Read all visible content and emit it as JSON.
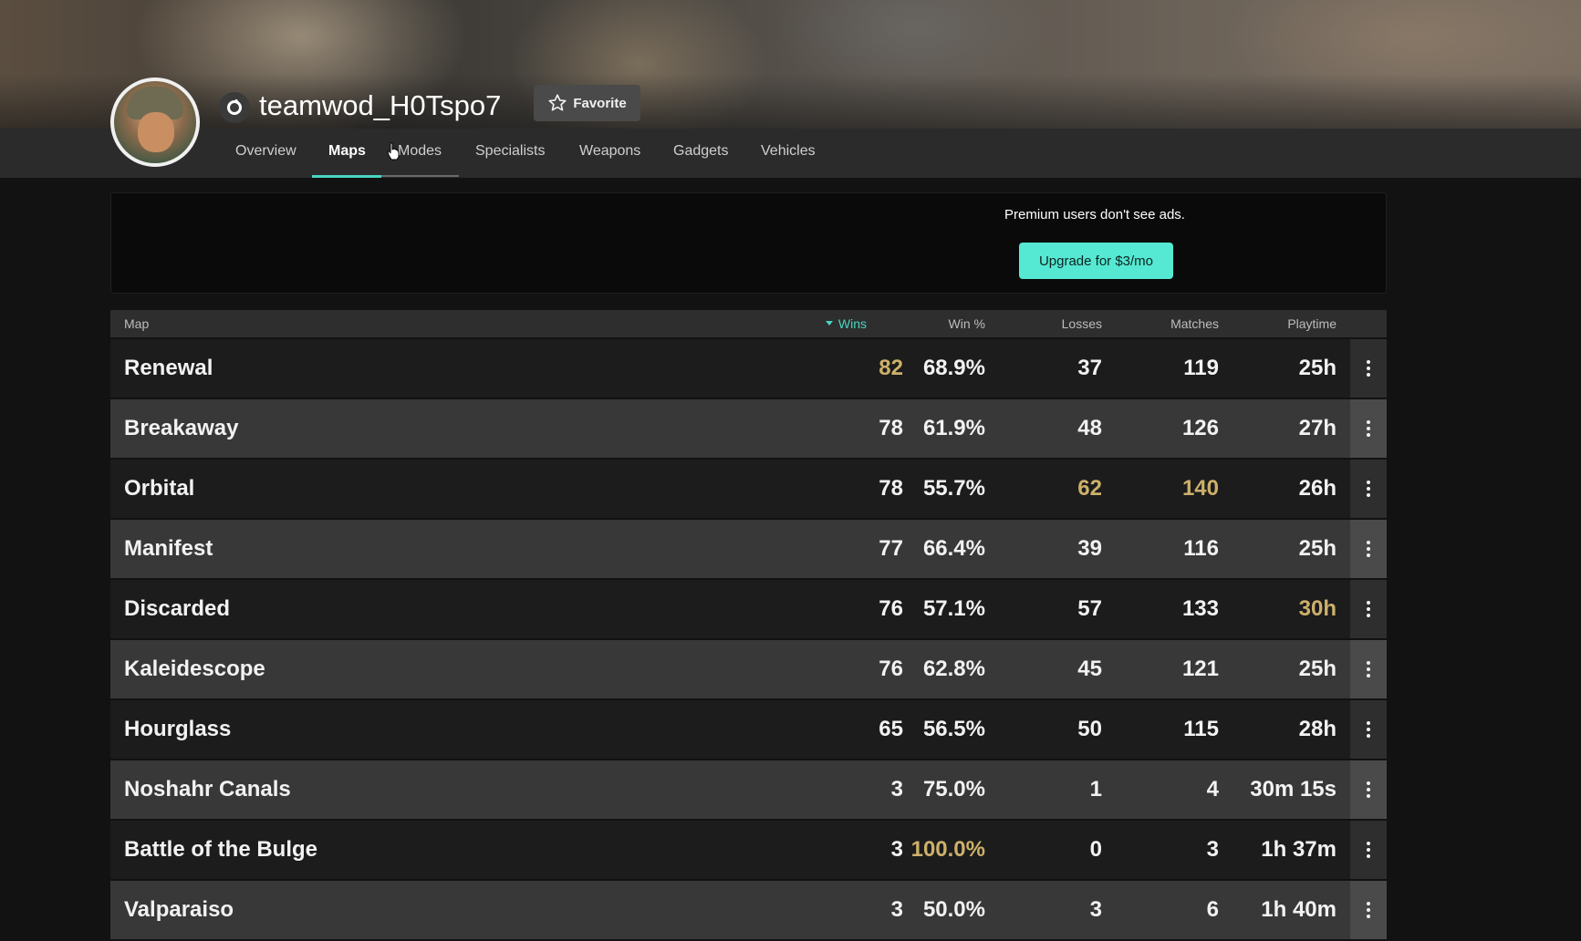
{
  "profile": {
    "username": "teamwod_H0Tspo7",
    "favorite_label": "Favorite",
    "platform_icon": "origin-icon"
  },
  "tabs": [
    {
      "label": "Overview",
      "active": false
    },
    {
      "label": "Maps",
      "active": true
    },
    {
      "label": "Modes",
      "active": false
    },
    {
      "label": "Specialists",
      "active": false
    },
    {
      "label": "Weapons",
      "active": false
    },
    {
      "label": "Gadgets",
      "active": false
    },
    {
      "label": "Vehicles",
      "active": false
    }
  ],
  "ad": {
    "text": "Premium users don't see ads.",
    "upgrade_label": "Upgrade for $3/mo"
  },
  "table": {
    "columns": {
      "map": "Map",
      "wins": "Wins",
      "win_pct": "Win %",
      "losses": "Losses",
      "matches": "Matches",
      "playtime": "Playtime"
    },
    "sorted_by": "wins",
    "highlight_color": "#cdb06a",
    "accent_color": "#48d6c2",
    "rows": [
      {
        "map": "Renewal",
        "wins": "82",
        "win_pct": "68.9%",
        "losses": "37",
        "matches": "119",
        "playtime": "25h"
      },
      {
        "map": "Breakaway",
        "wins": "78",
        "win_pct": "61.9%",
        "losses": "48",
        "matches": "126",
        "playtime": "27h"
      },
      {
        "map": "Orbital",
        "wins": "78",
        "win_pct": "55.7%",
        "losses": "62",
        "matches": "140",
        "playtime": "26h"
      },
      {
        "map": "Manifest",
        "wins": "77",
        "win_pct": "66.4%",
        "losses": "39",
        "matches": "116",
        "playtime": "25h"
      },
      {
        "map": "Discarded",
        "wins": "76",
        "win_pct": "57.1%",
        "losses": "57",
        "matches": "133",
        "playtime": "30h"
      },
      {
        "map": "Kaleidescope",
        "wins": "76",
        "win_pct": "62.8%",
        "losses": "45",
        "matches": "121",
        "playtime": "25h"
      },
      {
        "map": "Hourglass",
        "wins": "65",
        "win_pct": "56.5%",
        "losses": "50",
        "matches": "115",
        "playtime": "28h"
      },
      {
        "map": "Noshahr Canals",
        "wins": "3",
        "win_pct": "75.0%",
        "losses": "1",
        "matches": "4",
        "playtime": "30m 15s"
      },
      {
        "map": "Battle of the Bulge",
        "wins": "3",
        "win_pct": "100.0%",
        "losses": "0",
        "matches": "3",
        "playtime": "1h 37m"
      },
      {
        "map": "Valparaiso",
        "wins": "3",
        "win_pct": "50.0%",
        "losses": "3",
        "matches": "6",
        "playtime": "1h 40m"
      }
    ]
  }
}
